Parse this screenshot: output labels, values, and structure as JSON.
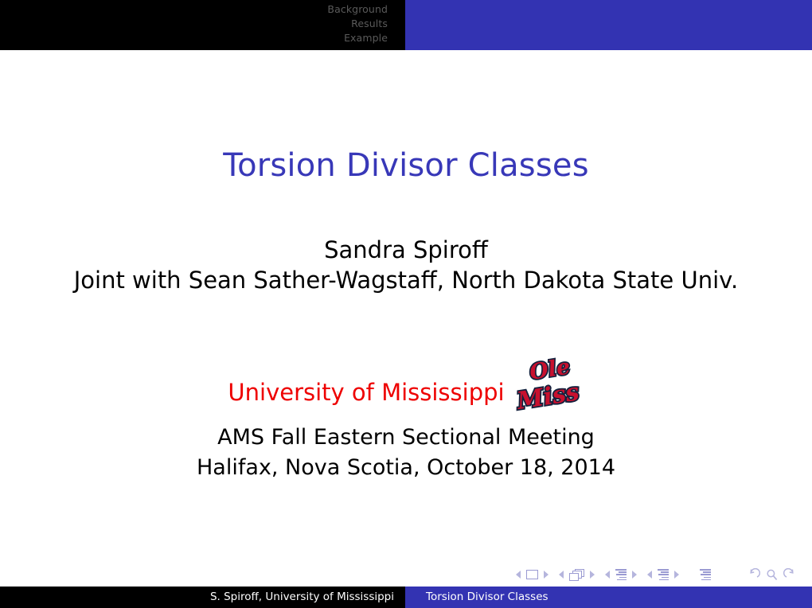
{
  "header": {
    "sections": [
      {
        "label": "Background"
      },
      {
        "label": "Results"
      },
      {
        "label": "Example"
      }
    ],
    "accent_color": "#3333b2",
    "text_color": "#5a5a5a"
  },
  "title_slide": {
    "title": "Torsion Divisor Classes",
    "title_color": "#3838b8",
    "author": "Sandra Spiroff",
    "joint_author": "Joint with Sean Sather-Wagstaff, North Dakota State Univ.",
    "institute": "University of Mississippi",
    "institute_color": "#ee0000",
    "logo": {
      "name": "ole-miss-logo",
      "line1": "Ole",
      "line2": "Miss",
      "fill_color": "#c8102e",
      "outline_color": "#14213d"
    },
    "event_line1": "AMS Fall Eastern Sectional Meeting",
    "event_line2": "Halifax, Nova Scotia, October 18, 2014"
  },
  "navigation": {
    "symbols": [
      {
        "name": "slide-nav",
        "icon": "slide-icon"
      },
      {
        "name": "frame-nav",
        "icon": "frames-icon"
      },
      {
        "name": "subsection-nav",
        "icon": "lines-icon"
      },
      {
        "name": "section-nav",
        "icon": "lines-icon"
      },
      {
        "name": "document-nav",
        "icon": "lines-icon"
      }
    ],
    "actions": [
      {
        "name": "back-action",
        "icon": "back-arrow-icon"
      },
      {
        "name": "search-action",
        "icon": "magnifier-icon"
      },
      {
        "name": "forward-action",
        "icon": "forward-arrow-icon"
      }
    ]
  },
  "footer": {
    "left_text": "S. Spiroff, University of Mississippi",
    "right_text": "Torsion Divisor Classes",
    "accent_color": "#3333b2"
  }
}
